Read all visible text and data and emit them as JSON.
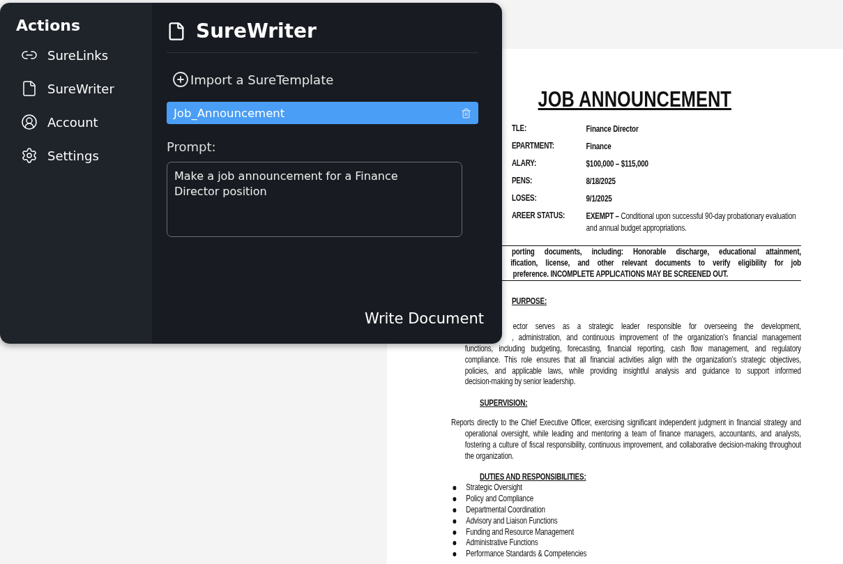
{
  "sidebar": {
    "title": "Actions",
    "items": [
      {
        "label": "SureLinks"
      },
      {
        "label": "SureWriter"
      },
      {
        "label": "Account"
      },
      {
        "label": "Settings"
      }
    ]
  },
  "panel": {
    "title": "SureWriter",
    "import_label": "Import a SureTemplate",
    "templates": [
      {
        "name": "Job_Announcement",
        "selected": true
      }
    ],
    "prompt_label": "Prompt:",
    "prompt_value": "Make a job announcement for a Finance Director position",
    "action": "Write Document"
  },
  "document": {
    "title": "JOB ANNOUNCEMENT",
    "fields": [
      {
        "label": "TLE:",
        "value": "Finance Director"
      },
      {
        "label": "EPARTMENT:",
        "value": "Finance"
      },
      {
        "label": "ALARY:",
        "value": "$100,000 – $115,000"
      },
      {
        "label": "PENS:",
        "value": "8/18/2025"
      },
      {
        "label": "LOSES:",
        "value": "9/1/2025"
      },
      {
        "label": "AREER STATUS:",
        "value": "**EXEMPT –** Conditional upon successful 90-day probationary evaluation and annual budget appropriations."
      }
    ],
    "notice_lines": [
      "porting documents, including: Honorable discharge, educational attainment,",
      "ification, license, and other relevant documents to verify eligibility for job",
      "preference. INCOMPLETE APPLICATIONS MAY BE SCREENED OUT."
    ],
    "purpose": {
      "heading": "PURPOSE:",
      "lines": [
        "ector serves as a strategic leader responsible for overseeing the development,",
        ", administration, and continuous improvement of the organization’s financial management",
        "functions, including budgeting, forecasting, financial reporting, cash flow management, and regulatory",
        "compliance. This role ensures that all financial activities align with the organization’s strategic objectives,",
        "policies, and applicable laws, while providing insightful analysis and guidance to support informed",
        "decision-making by senior leadership."
      ]
    },
    "supervision": {
      "heading": "SUPERVISION:",
      "text": "Reports directly to the Chief Executive Officer, exercising significant independent judgment in financial strategy and operational oversight, while leading and mentoring a team of finance managers, accountants, and analysts, fostering a culture of fiscal responsibility, continuous improvement, and collaborative decision-making throughout the organization."
    },
    "duties": {
      "heading": "DUTIES AND RESPONSIBILITIES:",
      "items": [
        "Strategic Oversight",
        "Policy and Compliance",
        "Departmental Coordination",
        "Advisory and Liaison Functions",
        "Funding and Resource Management",
        "Administrative Functions",
        "Performance Standards & Competencies"
      ]
    }
  }
}
